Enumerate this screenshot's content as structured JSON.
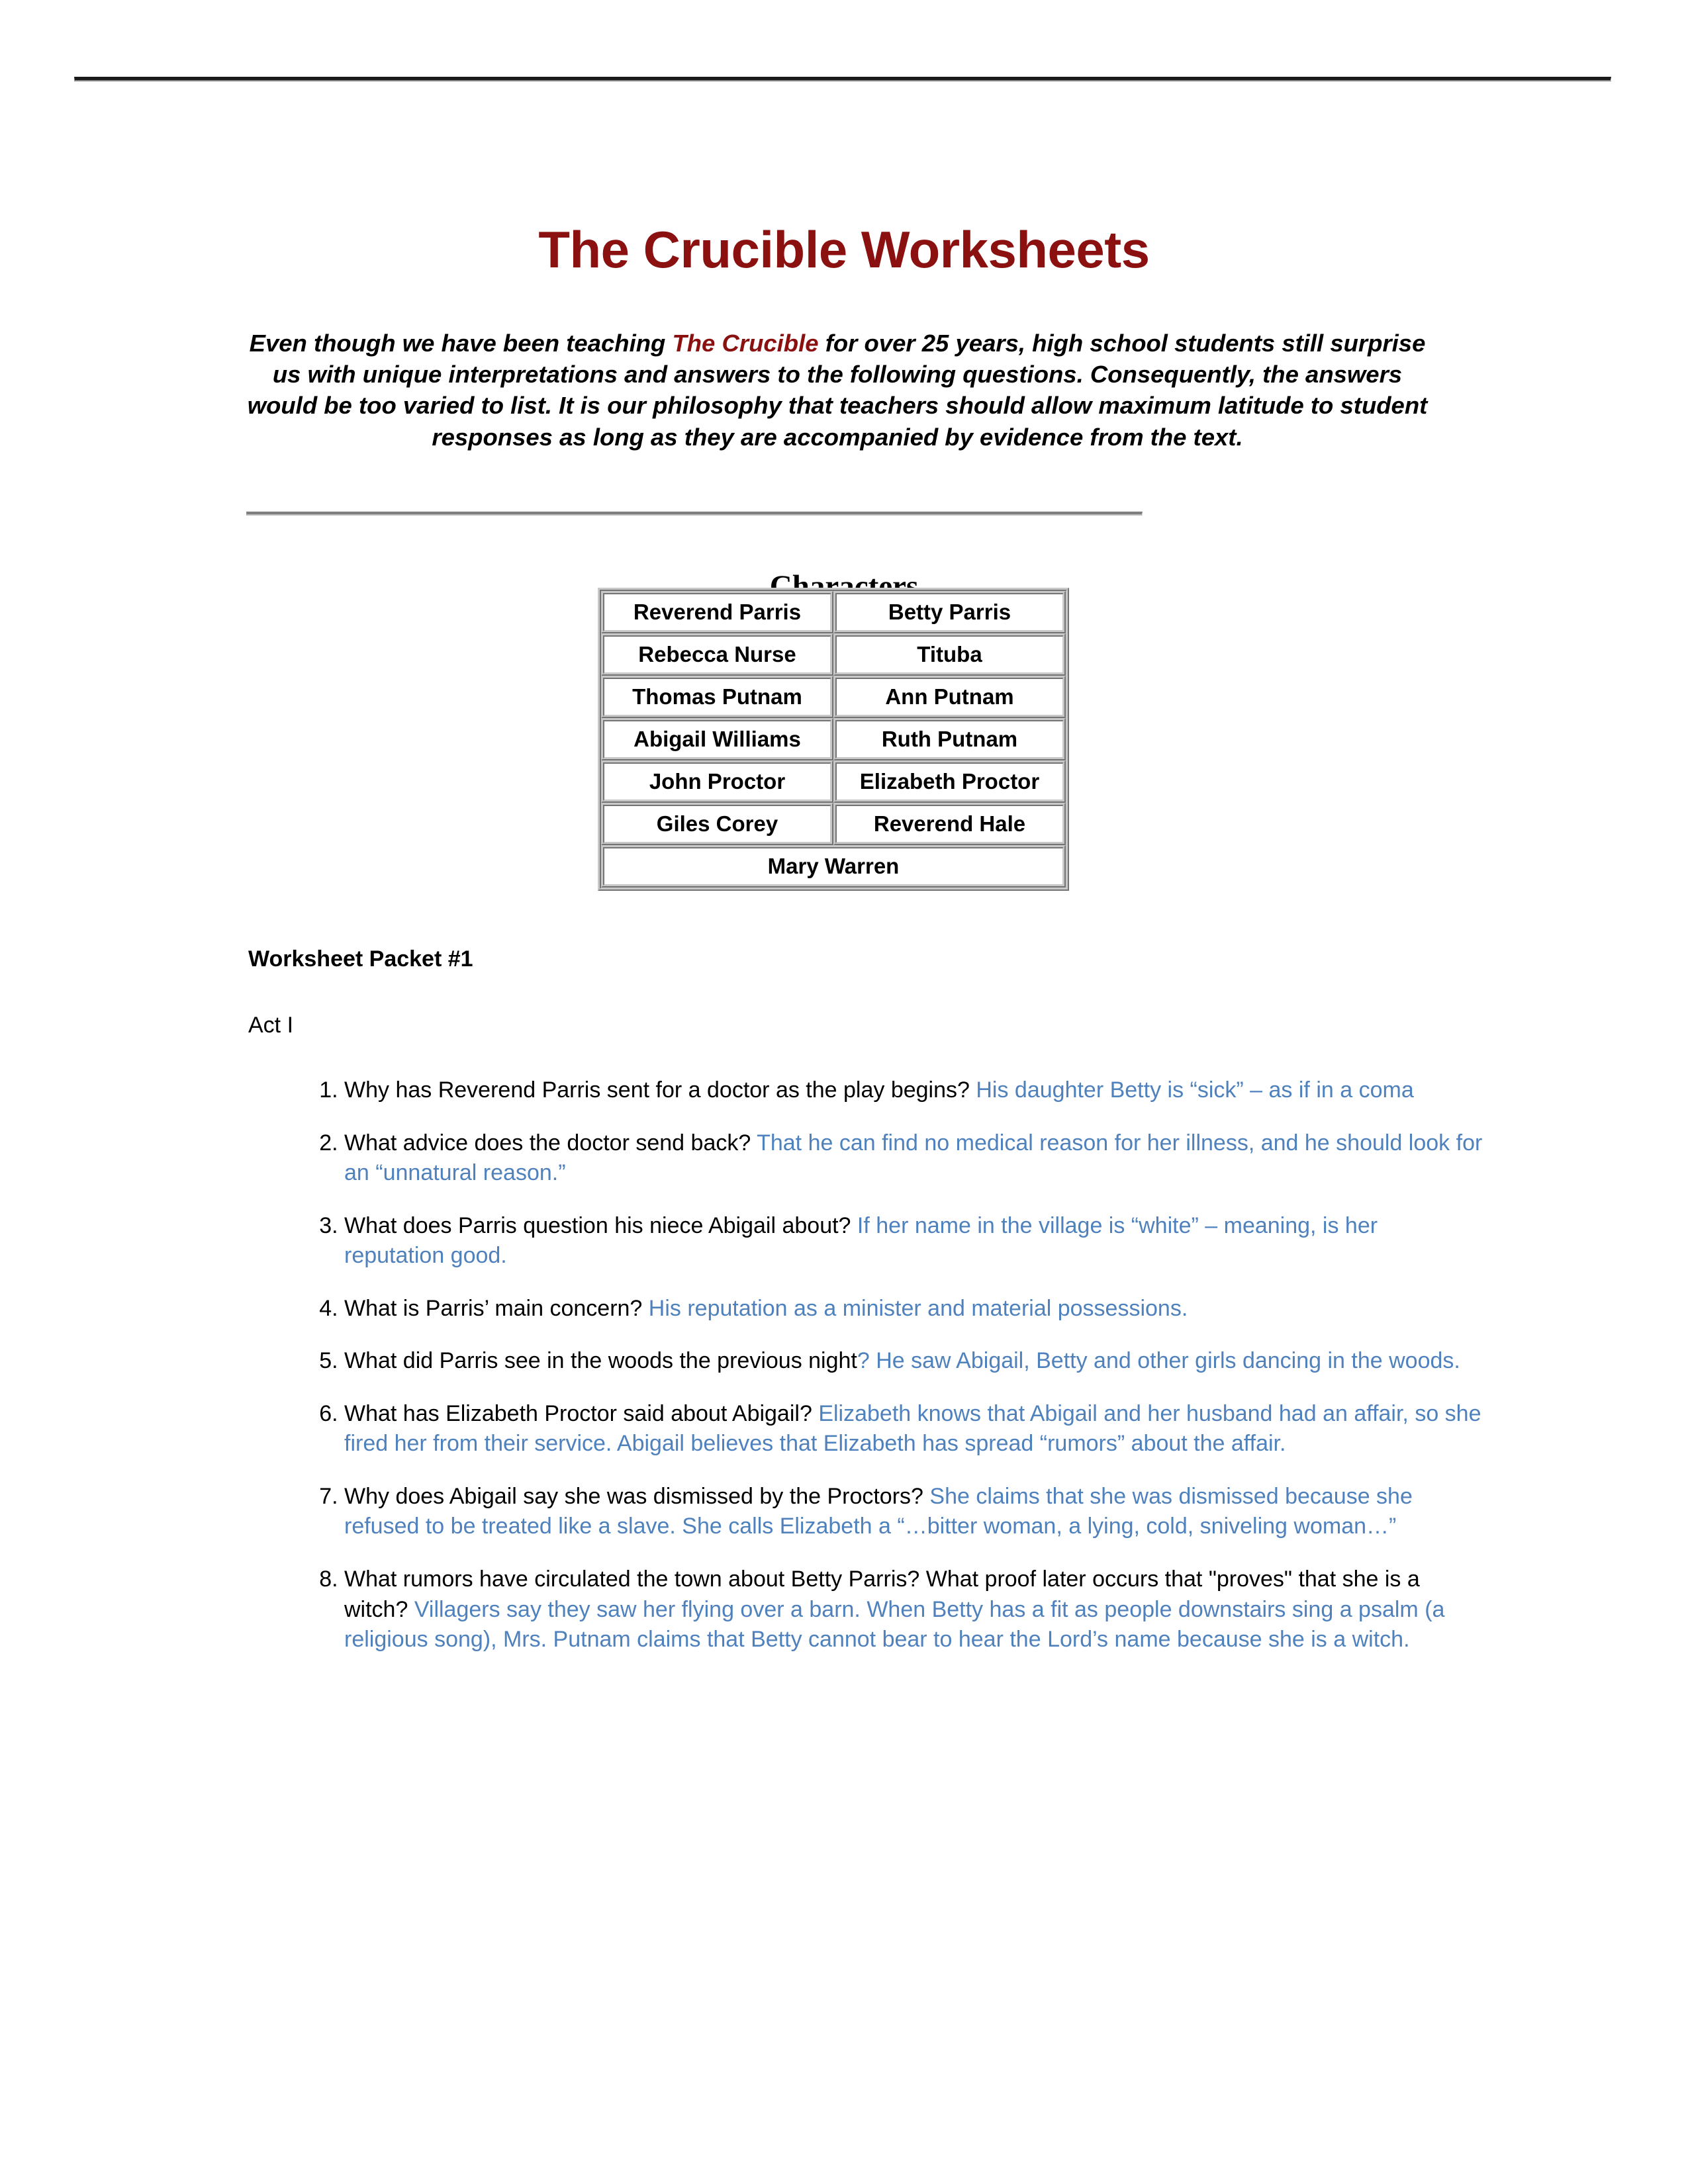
{
  "document": {
    "title": "The Crucible Worksheets",
    "intro": {
      "before": "Even though we have been teaching ",
      "emphasis": "The Crucible",
      "after": " for over 25 years, high school students still surprise us with unique interpretations and answers to the following questions.  Consequently, the answers would be too varied to list.  It is our philosophy that teachers should allow maximum latitude to student responses as long as they are accompanied by evidence from the text."
    },
    "characters_heading": "Characters",
    "characters_rows": [
      [
        "Reverend Parris",
        "Betty Parris"
      ],
      [
        "Rebecca Nurse",
        "Tituba"
      ],
      [
        "Thomas Putnam",
        "Ann Putnam"
      ],
      [
        "Abigail Williams",
        "Ruth Putnam"
      ],
      [
        "John Proctor",
        "Elizabeth Proctor"
      ],
      [
        "Giles Corey",
        "Reverend Hale"
      ]
    ],
    "characters_last_row": "Mary Warren",
    "packet_label": "Worksheet Packet #1",
    "act_label": "Act I",
    "questions": [
      {
        "question": "Why has Reverend Parris sent for a doctor as the play begins? ",
        "answer": "His daughter Betty is “sick” – as if in a coma"
      },
      {
        "question": "What advice does the doctor send back? ",
        "answer": "That he can find no medical reason for her illness, and he should look for an “unnatural reason.”"
      },
      {
        "question": "What does Parris question his niece Abigail about? ",
        "answer": "If her name in the village is “white” – meaning, is her reputation good."
      },
      {
        "question": "What is Parris’ main concern? ",
        "answer": "His reputation as a minister and material possessions."
      },
      {
        "question": "What did Parris see in the woods the previous night",
        "answer": "? He saw Abigail, Betty and other girls dancing in the woods."
      },
      {
        "question": "What has Elizabeth Proctor said about Abigail? ",
        "answer": "Elizabeth knows that Abigail and her husband had an affair, so she fired her from their service. Abigail believes that Elizabeth has spread “rumors” about the affair."
      },
      {
        "question": "Why does Abigail say she was dismissed by the Proctors? ",
        "answer": "She claims that she was dismissed because she refused to be treated like a slave. She calls Elizabeth a “…bitter woman, a lying, cold, sniveling woman…”"
      },
      {
        "question": "What rumors have circulated the town about Betty Parris? What proof later occurs that \"proves\" that she is a witch? ",
        "answer": "Villagers say they saw her flying over a barn. When Betty has a fit as people downstairs sing a psalm (a religious song), Mrs. Putnam claims that Betty cannot bear to hear the Lord’s name because she is a witch."
      }
    ],
    "colors": {
      "title_red": "#8b1010",
      "answer_blue": "#4f81bd",
      "rule_dark": "#1a1a1a",
      "rule_gray": "#7f7f7f",
      "table_border": "#c8c8c8"
    }
  }
}
